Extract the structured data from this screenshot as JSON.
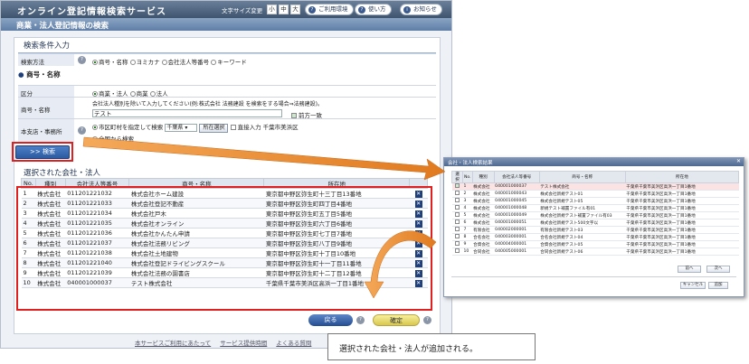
{
  "header": {
    "title": "オンライン登記情報検索サービス",
    "font_size_label": "文字サイズ変更",
    "font_sizes": [
      "小",
      "中",
      "大"
    ],
    "env_label": "ご利用環境",
    "howto_label": "使い方",
    "notice_label": "お知らせ"
  },
  "subheader": {
    "title": "商業・法人登記情報の検索"
  },
  "search": {
    "section_title": "検索条件入力",
    "method_label": "検索方法",
    "methods": [
      "商号・名称",
      "ヨミカナ",
      "会社法人等番号",
      "キーワード"
    ],
    "name_section": "商号・名称",
    "category_label": "区分",
    "categories": [
      "商業・法人",
      "商業",
      "法人"
    ],
    "name_label": "商号・名称",
    "name_hint": "会社法人種別を除いて入力してください(例:株式会社 法務建設 を検索をする場合⇒法務建設)。",
    "name_value": "テスト",
    "prefix_match": "前方一致",
    "office_label": "本支店・事務所",
    "city_specify": "市区町村を指定して検索",
    "pref_value": "千葉県",
    "place_select_btn": "所在選択",
    "direct_input": "直接入力",
    "city_value": "千葉市美浜区",
    "nationwide": "全国から検索",
    "search_btn": ">> 検索"
  },
  "results": {
    "section_title": "選択された会社・法人",
    "columns": [
      "No.",
      "種別",
      "会社法人等番号",
      "商号・名称",
      "所在地",
      ""
    ],
    "rows": [
      {
        "no": "1",
        "type": "株式会社",
        "num": "011201221032",
        "name": "株式会社ホーム建設",
        "addr": "東京都中野区弥生町十三丁目13番地"
      },
      {
        "no": "2",
        "type": "株式会社",
        "num": "011201221033",
        "name": "株式会社登記不動産",
        "addr": "東京都中野区弥生町四丁目4番地"
      },
      {
        "no": "3",
        "type": "株式会社",
        "num": "011201221034",
        "name": "株式会社戸木",
        "addr": "東京都中野区弥生町五丁目5番地"
      },
      {
        "no": "4",
        "type": "株式会社",
        "num": "011201221035",
        "name": "株式会社オンライン",
        "addr": "東京都中野区弥生町六丁目6番地"
      },
      {
        "no": "5",
        "type": "株式会社",
        "num": "011201221036",
        "name": "株式会社かんたん申請",
        "addr": "東京都中野区弥生町七丁目7番地"
      },
      {
        "no": "6",
        "type": "株式会社",
        "num": "011201221037",
        "name": "株式会社法務リビング",
        "addr": "東京都中野区弥生町八丁目9番地"
      },
      {
        "no": "7",
        "type": "株式会社",
        "num": "011201221038",
        "name": "株式会社土地建物",
        "addr": "東京都中野区弥生町十丁目10番地"
      },
      {
        "no": "8",
        "type": "株式会社",
        "num": "011201221040",
        "name": "株式会社登記ドライビングスクール",
        "addr": "東京都中野区弥生町十一丁目11番地"
      },
      {
        "no": "9",
        "type": "株式会社",
        "num": "011201221039",
        "name": "株式会社法務の園書店",
        "addr": "東京都中野区弥生町十二丁目12番地"
      },
      {
        "no": "10",
        "type": "株式会社",
        "num": "040001000037",
        "name": "テスト株式会社",
        "addr": "千葉県千葉市美浜区高浜一丁目1番地"
      }
    ],
    "back_btn": "戻る",
    "confirm_btn": "確定"
  },
  "footer": {
    "links": [
      "本サービスご利用にあたって",
      "サービス提供時間",
      "よくある質問"
    ]
  },
  "dialog": {
    "title": "会社・法人検索結果",
    "columns": [
      "選択",
      "No.",
      "種別",
      "会社法人等番号",
      "商号・名称",
      "所在地"
    ],
    "rows": [
      {
        "no": "1",
        "type": "株式会社",
        "num": "040001000037",
        "name": "テスト株式会社",
        "addr": "千葉県千葉市美浜区高浜一丁目1番地",
        "checked": true
      },
      {
        "no": "2",
        "type": "株式会社",
        "num": "040001000043",
        "name": "株式会社新規テスト01",
        "addr": "千葉県千葉市美浜区高浜一丁目1番地"
      },
      {
        "no": "3",
        "type": "株式会社",
        "num": "040001000045",
        "name": "株式会社新規テスト05",
        "addr": "千葉県千葉市美浜区高浜一丁目1番地"
      },
      {
        "no": "4",
        "type": "株式会社",
        "num": "040001000048",
        "name": "新規テスト補置ファイル有01",
        "addr": "千葉県千葉市美浜区高浜一丁目1番地"
      },
      {
        "no": "5",
        "type": "株式会社",
        "num": "040001000049",
        "name": "株式会社新規テスト補置ファイル有03",
        "addr": "千葉県千葉市美浜区高浜一丁目1番地"
      },
      {
        "no": "6",
        "type": "株式会社",
        "num": "040001000051",
        "name": "株式会社新規テスト500文字以",
        "addr": "千葉県千葉市美浜区高浜一丁目1番地"
      },
      {
        "no": "7",
        "type": "有限会社",
        "num": "040002000001",
        "name": "有限会社新規テスト03",
        "addr": "千葉県千葉市美浜区高浜一丁目1番地"
      },
      {
        "no": "8",
        "type": "合名会社",
        "num": "040003000001",
        "name": "合名会社新規テスト04",
        "addr": "千葉県千葉市美浜区高浜一丁目1番地"
      },
      {
        "no": "9",
        "type": "合資会社",
        "num": "040004000001",
        "name": "合資会社新規テスト05",
        "addr": "千葉県千葉市美浜区高浜一丁目1番地"
      },
      {
        "no": "10",
        "type": "合同会社",
        "num": "040005000001",
        "name": "合同会社新規テスト06",
        "addr": "千葉県千葉市美浜区高浜一丁目1番地"
      }
    ],
    "prev_btn": "前へ",
    "next_btn": "次へ",
    "cancel_btn": "キャンセル",
    "add_btn": "追加"
  },
  "caption": "選択された会社・法人が追加される。"
}
